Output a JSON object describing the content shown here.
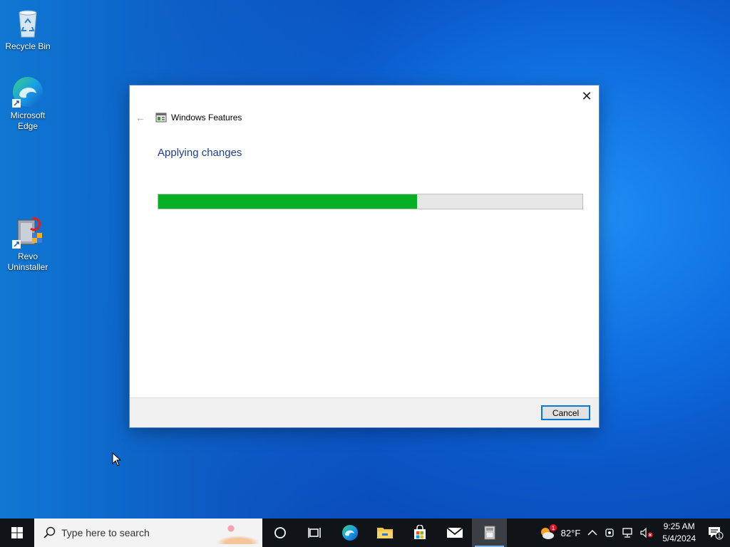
{
  "desktop": {
    "icons": [
      {
        "label": "Recycle Bin"
      },
      {
        "label": "Microsoft Edge"
      },
      {
        "label": "Revo Uninstaller"
      }
    ]
  },
  "dialog": {
    "title": "Windows Features",
    "heading": "Applying changes",
    "progress_fraction": 0.61,
    "close_symbol": "✕",
    "back_symbol": "←",
    "cancel_label": "Cancel"
  },
  "taskbar": {
    "search_placeholder": "Type here to search",
    "apps": [
      "cortana-icon",
      "task-view-icon",
      "edge-icon",
      "file-explorer-icon",
      "store-icon",
      "mail-icon",
      "windows-features-icon"
    ],
    "weather": {
      "temp": "82°F",
      "badge": "1"
    },
    "clock": {
      "time": "9:25 AM",
      "date": "5/4/2024"
    },
    "notifications_count": "1"
  },
  "colors": {
    "progress_fill": "#06b025",
    "heading": "#1c3f94",
    "accent": "#0078d7",
    "taskbar": "#101318"
  }
}
